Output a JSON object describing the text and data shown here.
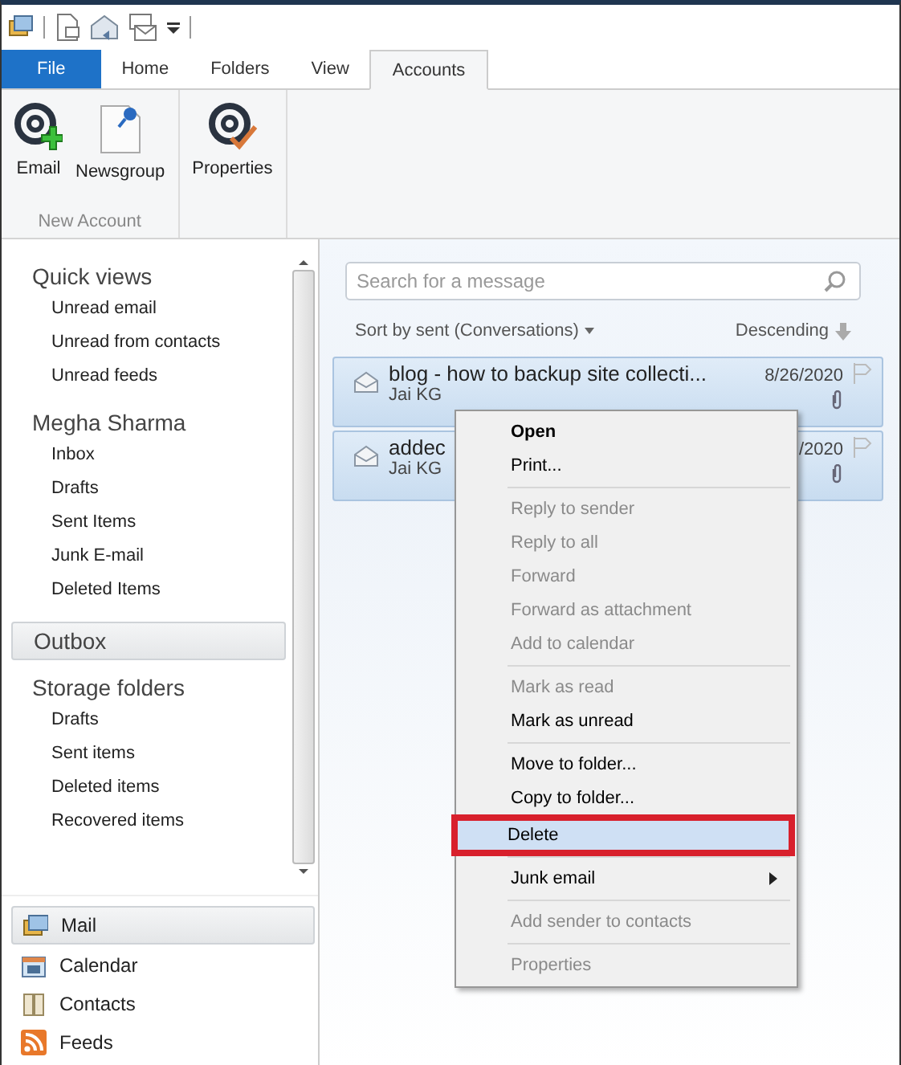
{
  "ribbon_tabs": [
    {
      "label": "File",
      "kind": "file",
      "selected": false
    },
    {
      "label": "Home",
      "kind": "tab",
      "selected": false
    },
    {
      "label": "Folders",
      "kind": "tab",
      "selected": false
    },
    {
      "label": "View",
      "kind": "tab",
      "selected": false
    },
    {
      "label": "Accounts",
      "kind": "tab",
      "selected": true
    }
  ],
  "ribbon_groups": [
    {
      "label": "New Account",
      "buttons": [
        {
          "label": "Email"
        },
        {
          "label": "Newsgroup"
        }
      ]
    },
    {
      "buttons": [
        {
          "label": "Properties"
        }
      ]
    }
  ],
  "sidebar": {
    "sections": [
      {
        "title": "Quick views",
        "selected": false,
        "items": [
          "Unread email",
          "Unread from contacts",
          "Unread feeds"
        ]
      },
      {
        "title": "Megha Sharma",
        "selected": false,
        "items": [
          "Inbox",
          "Drafts",
          "Sent Items",
          "Junk E-mail",
          "Deleted Items"
        ]
      },
      {
        "title": "Outbox",
        "selected": true
      },
      {
        "title": "Storage folders",
        "selected": false,
        "items": [
          "Drafts",
          "Sent items",
          "Deleted items",
          "Recovered items"
        ]
      }
    ],
    "nav": [
      {
        "label": "Mail",
        "selected": true
      },
      {
        "label": "Calendar",
        "selected": false
      },
      {
        "label": "Contacts",
        "selected": false
      },
      {
        "label": "Feeds",
        "selected": false
      }
    ]
  },
  "search": {
    "placeholder": "Search for a message"
  },
  "sort": {
    "label": "Sort by sent (Conversations)",
    "order": "Descending"
  },
  "messages": [
    {
      "subject": "blog - how to backup site collecti...",
      "sender": "Jai KG",
      "date": "8/26/2020",
      "selected": true
    },
    {
      "subject": "addec",
      "sender": "Jai KG",
      "date": "/2020",
      "selected": true
    }
  ],
  "context_menu": {
    "groups": [
      [
        {
          "label": "Open",
          "default": true,
          "disabled": false,
          "selected": false,
          "submenu": false,
          "marked": false
        },
        {
          "label": "Print...",
          "default": false,
          "disabled": false,
          "selected": false,
          "submenu": false,
          "marked": false
        }
      ],
      [
        {
          "label": "Reply to sender",
          "default": false,
          "disabled": true,
          "selected": false,
          "submenu": false,
          "marked": false
        },
        {
          "label": "Reply to all",
          "default": false,
          "disabled": true,
          "selected": false,
          "submenu": false,
          "marked": false
        },
        {
          "label": "Forward",
          "default": false,
          "disabled": true,
          "selected": false,
          "submenu": false,
          "marked": false
        },
        {
          "label": "Forward as attachment",
          "default": false,
          "disabled": true,
          "selected": false,
          "submenu": false,
          "marked": false
        },
        {
          "label": "Add to calendar",
          "default": false,
          "disabled": true,
          "selected": false,
          "submenu": false,
          "marked": false
        }
      ],
      [
        {
          "label": "Mark as read",
          "default": false,
          "disabled": true,
          "selected": false,
          "submenu": false,
          "marked": false
        },
        {
          "label": "Mark as unread",
          "default": false,
          "disabled": false,
          "selected": false,
          "submenu": false,
          "marked": false
        }
      ],
      [
        {
          "label": "Move to folder...",
          "default": false,
          "disabled": false,
          "selected": false,
          "submenu": false,
          "marked": false
        },
        {
          "label": "Copy to folder...",
          "default": false,
          "disabled": false,
          "selected": false,
          "submenu": false,
          "marked": false
        },
        {
          "label": "Delete",
          "default": false,
          "disabled": false,
          "selected": true,
          "submenu": false,
          "marked": true
        }
      ],
      [
        {
          "label": "Junk email",
          "default": false,
          "disabled": false,
          "selected": false,
          "submenu": true,
          "marked": false
        }
      ],
      [
        {
          "label": "Add sender to contacts",
          "default": false,
          "disabled": true,
          "selected": false,
          "submenu": false,
          "marked": false
        }
      ],
      [
        {
          "label": "Properties",
          "default": false,
          "disabled": true,
          "selected": false,
          "submenu": false,
          "marked": false
        }
      ]
    ]
  }
}
